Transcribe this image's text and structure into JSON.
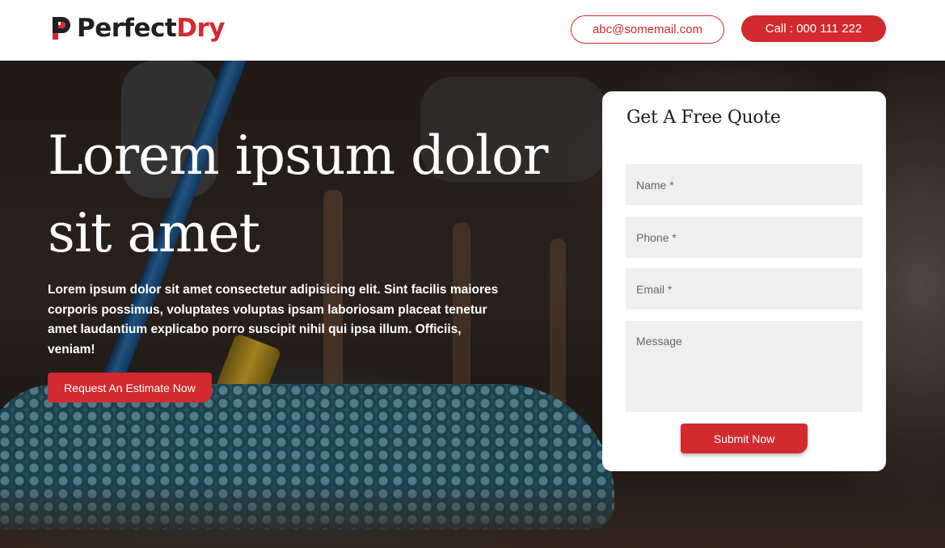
{
  "brand": {
    "name_part1": "Perfect",
    "name_part2": "Dry",
    "logo_icon": "pd-logo-mark",
    "accent_color": "#d32a2f"
  },
  "header": {
    "email_label": "abc@somemail.com",
    "call_label": "Call : 000 111 222"
  },
  "hero": {
    "title": "Lorem ipsum dolor sit amet",
    "text": "Lorem ipsum dolor sit amet consectetur adipisicing elit. Sint facilis maiores corporis possimus, voluptates voluptas ipsam laboriosam placeat tenetur amet laudantium explicabo porro suscipit nihil qui ipsa illum. Officiis, veniam!",
    "cta_label": "Request An Estimate Now"
  },
  "quote_form": {
    "title": "Get A Free Quote",
    "name_placeholder": "Name *",
    "phone_placeholder": "Phone *",
    "email_placeholder": "Email *",
    "message_placeholder": "Message",
    "submit_label": "Submit Now"
  }
}
